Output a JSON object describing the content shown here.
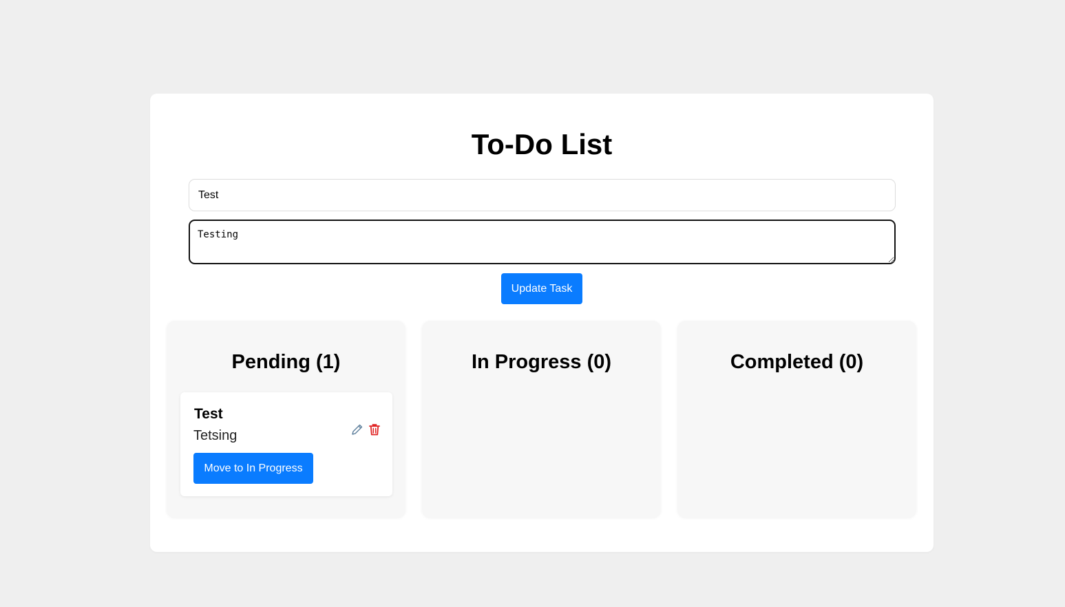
{
  "app": {
    "title": "To-Do List"
  },
  "form": {
    "title_value": "Test",
    "description_value": "Testing",
    "submit_label": "Update Task"
  },
  "columns": [
    {
      "title": "Pending (1)",
      "tasks": [
        {
          "title": "Test",
          "description": "Tetsing",
          "move_label": "Move to In Progress",
          "edit_icon": "pencil-icon",
          "delete_icon": "trash-icon"
        }
      ]
    },
    {
      "title": "In Progress (0)",
      "tasks": []
    },
    {
      "title": "Completed (0)",
      "tasks": []
    }
  ],
  "colors": {
    "accent": "#0a7cff",
    "delete": "#e02424",
    "edit": "#5b7d9a",
    "page_bg": "#efefef",
    "column_bg": "#f7f7f7"
  }
}
